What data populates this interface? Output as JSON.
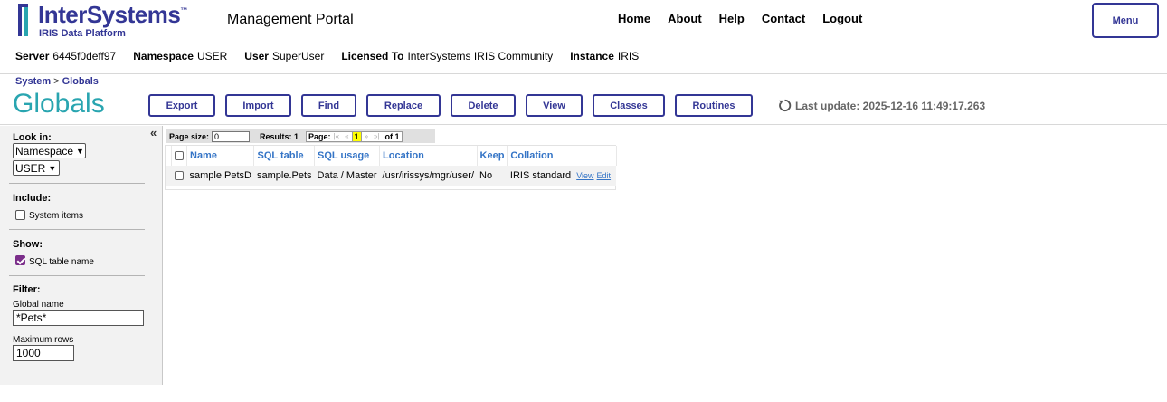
{
  "header": {
    "logo_name": "InterSystems",
    "logo_tm": "™",
    "logo_sub": "IRIS Data Platform",
    "portal_title": "Management Portal",
    "nav": [
      "Home",
      "About",
      "Help",
      "Contact",
      "Logout"
    ],
    "menu_label": "Menu",
    "brand_color": "#333695",
    "info": {
      "server_label": "Server",
      "server": "6445f0deff97",
      "namespace_label": "Namespace",
      "namespace": "USER",
      "user_label": "User",
      "user": "SuperUser",
      "licensed_label": "Licensed To",
      "licensed": "InterSystems IRIS Community",
      "instance_label": "Instance",
      "instance": "IRIS"
    }
  },
  "breadcrumb": {
    "root": "System",
    "separator": ">",
    "current": "Globals"
  },
  "page_title": "Globals",
  "title_color": "#29a5b0",
  "toolbar": {
    "buttons": [
      "Export",
      "Import",
      "Find",
      "Replace",
      "Delete",
      "View",
      "Classes",
      "Routines"
    ],
    "last_update": "Last update: 2025-12-16 11:49:17.263",
    "refresh_icon": "refresh-icon"
  },
  "left_panel": {
    "collapse_glyph": "«",
    "look_in_label": "Look in:",
    "look_in_type": "Namespace",
    "look_in_value": "USER",
    "include_label": "Include:",
    "system_items_label": "System items",
    "system_items_checked": false,
    "show_label": "Show:",
    "sql_table_name_label": "SQL table name",
    "sql_table_name_checked": true,
    "filter_label": "Filter:",
    "global_name_label": "Global name",
    "global_name_value": "*Pets*",
    "max_rows_label": "Maximum rows",
    "max_rows_value": "1000"
  },
  "pager": {
    "page_size_label": "Page size:",
    "page_size_value": "0",
    "results_label": "Results: 1",
    "page_label": "Page:",
    "nav_first": "|«",
    "nav_prev": "«",
    "current_page": "1",
    "nav_next": "»",
    "nav_last": "»|",
    "of_label": "of 1"
  },
  "table": {
    "columns": [
      "Name",
      "SQL table",
      "SQL usage",
      "Location",
      "Keep",
      "Collation"
    ],
    "rows": [
      {
        "name": "sample.PetsD",
        "sql_table": "sample.Pets",
        "sql_usage": "Data / Master",
        "location": "/usr/irissys/mgr/user/",
        "keep": "No",
        "collation": "IRIS standard",
        "view_link": "View",
        "edit_link": "Edit"
      }
    ],
    "header_color": "#3474c6"
  }
}
